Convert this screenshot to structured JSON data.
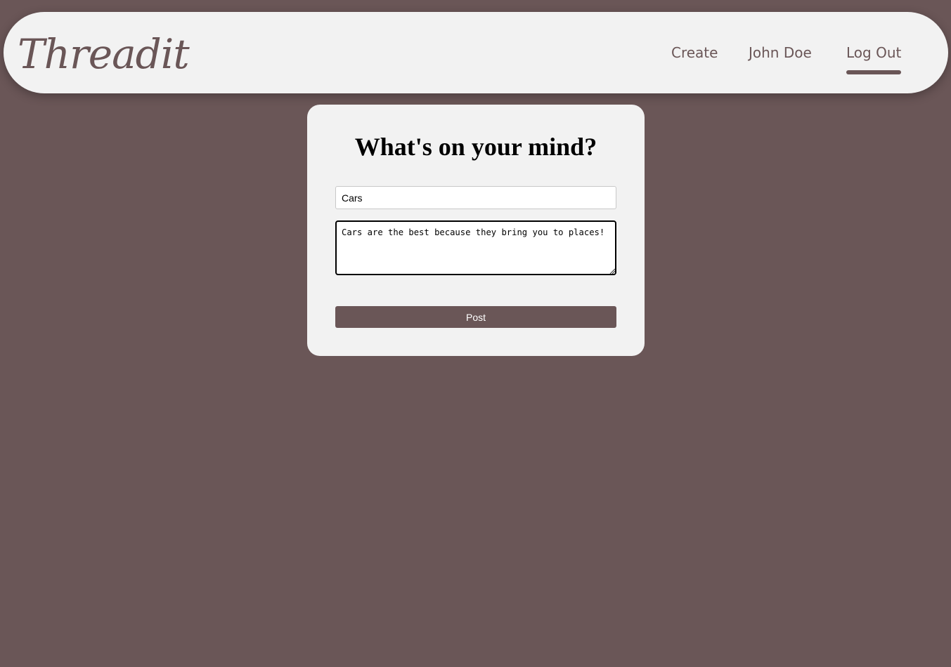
{
  "nav": {
    "logo_text": "Threadit",
    "links": [
      {
        "label": "Create"
      },
      {
        "label": "John Doe"
      },
      {
        "label": "Log Out",
        "active": true
      }
    ]
  },
  "form": {
    "heading": "What's on your mind?",
    "title_value": "Cars",
    "body_value": "Cars are the best because they bring you to places!",
    "post_label": "Post"
  },
  "colors": {
    "background": "#6a5657",
    "surface": "#f2f2f2",
    "accent": "#6a5657"
  }
}
